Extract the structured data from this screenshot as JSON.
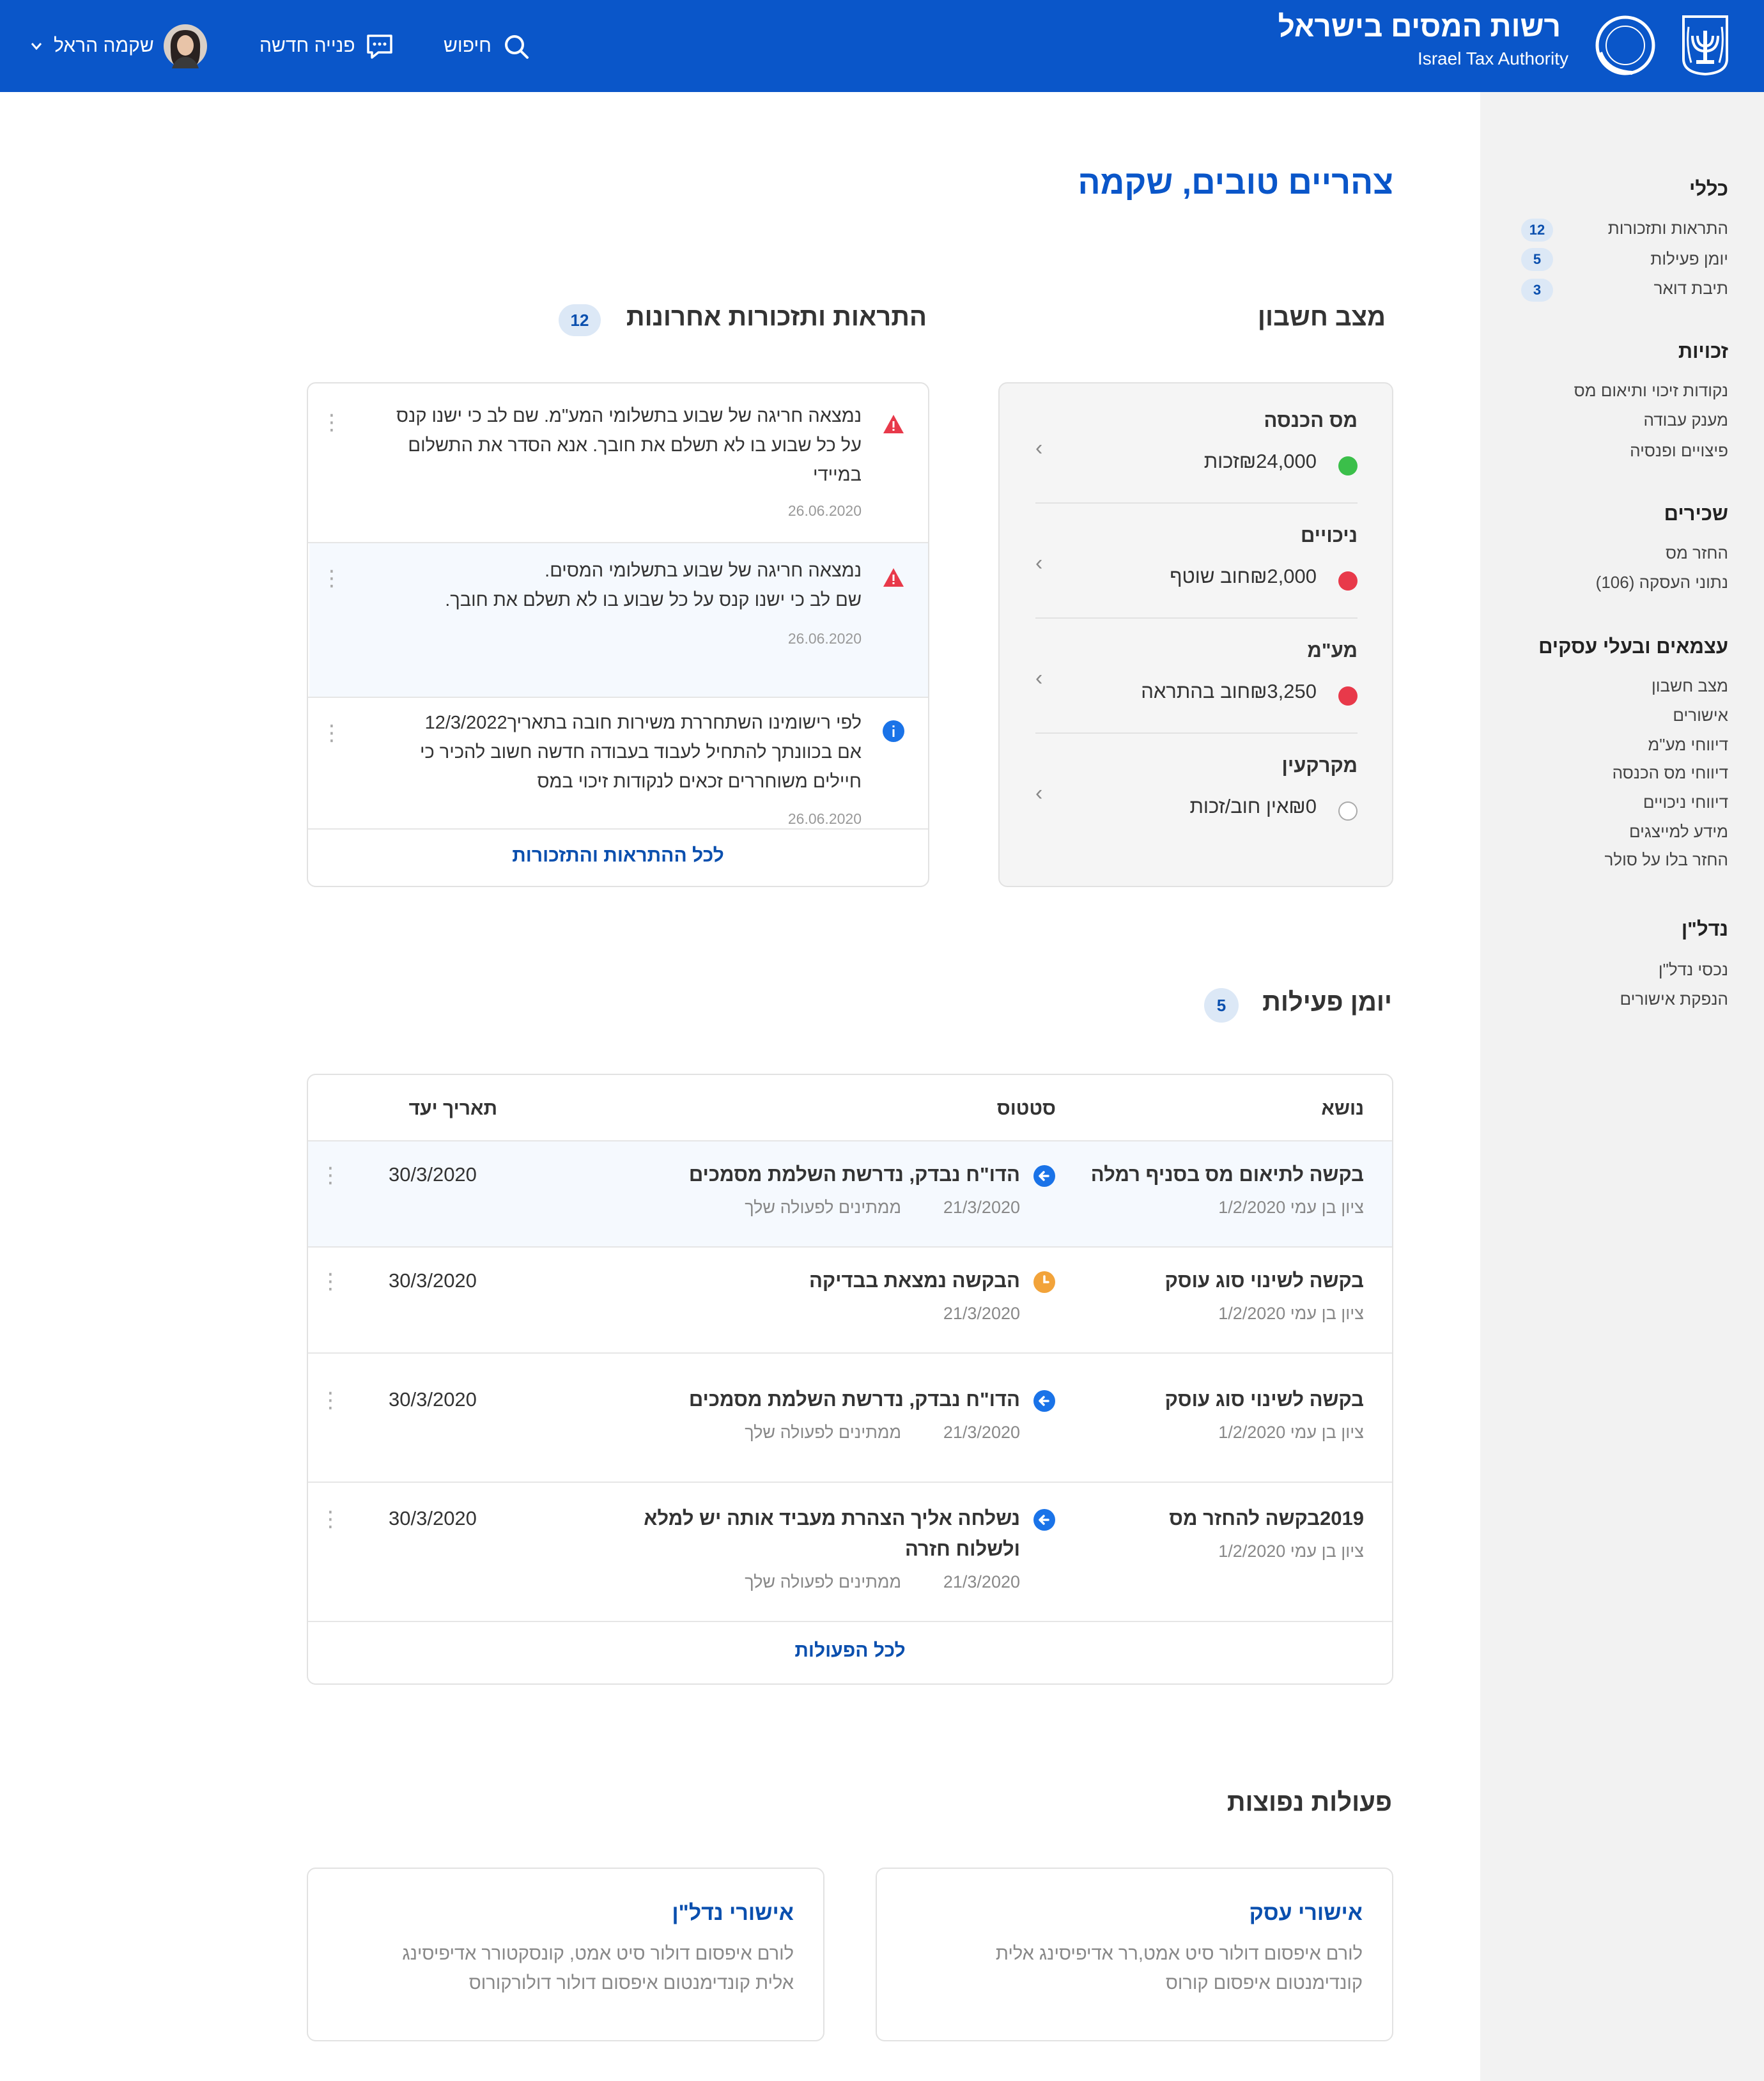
{
  "header": {
    "brand_he": "רשות המסים בישראל",
    "brand_en": "Israel Tax Authority",
    "search_label": "חיפוש",
    "new_inquiry_label": "פנייה חדשה",
    "user_name": "שקמה הראל"
  },
  "sidebar": {
    "sections": [
      {
        "title": "כללי",
        "items": [
          {
            "label": "התראות ותזכורות",
            "badge": "12"
          },
          {
            "label": "יומן פעילות",
            "badge": "5"
          },
          {
            "label": "תיבת דואר",
            "badge": "3"
          }
        ]
      },
      {
        "title": "זכויות",
        "items": [
          {
            "label": "נקודות זיכוי ותיאום מס"
          },
          {
            "label": "מענק עבודה"
          },
          {
            "label": "פיצויים ופנסיה"
          }
        ]
      },
      {
        "title": "שכירים",
        "items": [
          {
            "label": "החזר מס"
          },
          {
            "label": "(106) נתוני העסקה"
          }
        ]
      },
      {
        "title": "עצמאים ובעלי עסקים",
        "items": [
          {
            "label": "מצב חשבון"
          },
          {
            "label": "אישורים"
          },
          {
            "label": "דיווחי מע\"מ"
          },
          {
            "label": "דיווחי מס הכנסה"
          },
          {
            "label": "דיווחי ניכויים"
          },
          {
            "label": "מידע למייצגים"
          },
          {
            "label": "החזר בלו על סולר"
          }
        ]
      },
      {
        "title": "נדל\"ן",
        "items": [
          {
            "label": "נכסי נדל\"ן"
          },
          {
            "label": "הנפקת אישורים"
          }
        ]
      }
    ]
  },
  "main": {
    "greeting": "צהריים טובים, שקמה",
    "account": {
      "title": "מצב חשבון",
      "rows": [
        {
          "label": "מס הכנסה",
          "value": "₪24,000זכות",
          "status_color": "#3bbf4a"
        },
        {
          "label": "ניכויים",
          "value": "₪2,000חוב שוטף",
          "status_color": "#e8394a"
        },
        {
          "label": "מע\"מ",
          "value": "₪3,250חוב בהתראה",
          "status_color": "#e8394a"
        },
        {
          "label": "מקרקעין",
          "value": "₪0אין חוב/זכות",
          "status_color": "none"
        }
      ]
    },
    "alerts": {
      "title": "התראות ותזכורות אחרונות",
      "count": "12",
      "items": [
        {
          "type": "warning",
          "lines": [
            "נמצאה חריגה של שבוע בתשלומי המע\"מ. שם לב כי ישנו קנס",
            "על כל שבוע בו לא תשלם את חובך. אנא הסדר את התשלום",
            "במיידי"
          ],
          "date": "26.06.2020"
        },
        {
          "type": "warning",
          "lines": [
            "נמצאה חריגה של שבוע בתשלומי המסים.",
            "שם לב כי ישנו קנס על כל שבוע בו לא תשלם את חובך."
          ],
          "date": "26.06.2020"
        },
        {
          "type": "info",
          "lines": [
            "לפי רישומינו השתחררת משירות חובה בתאריך12/3/2022",
            "אם בכוונתך להתחיל לעבוד בעבודה חדשה חשוב להכיר כי",
            "חיילים משוחררים זכאים לנקודות זיכוי במס"
          ],
          "date": "26.06.2020"
        }
      ],
      "all_link": "לכל ההתראות והתזכורות"
    },
    "activity": {
      "title": "יומן פעילות",
      "count": "5",
      "columns": {
        "subject": "נושא",
        "status": "סטטוס",
        "due": "תאריך יעד"
      },
      "rows": [
        {
          "subject": "בקשה לתיאום מס בסניף רמלה",
          "subject_sub": "ציון בן עמי 1/2/2020",
          "status": "הדו\"ח נבדק, נדרשת השלמת מסמכים",
          "status_lines": [
            "הדו\"ח נבדק, נדרשת השלמת מסמכים"
          ],
          "status_date": "21/3/2020",
          "status_note": "ממתינים לפעולה שלך",
          "icon": "arrow",
          "due": "30/3/2020"
        },
        {
          "subject": "בקשה לשינוי סוג עוסק",
          "subject_sub": "ציון בן עמי 1/2/2020",
          "status_lines": [
            "הבקשה נמצאת בבדיקה"
          ],
          "status_date": "21/3/2020",
          "status_note": "",
          "icon": "clock",
          "due": "30/3/2020"
        },
        {
          "subject": "בקשה לשינוי סוג עוסק",
          "subject_sub": "ציון בן עמי 1/2/2020",
          "status_lines": [
            "הדו\"ח נבדק, נדרשת השלמת מסמכים"
          ],
          "status_date": "21/3/2020",
          "status_note": "ממתינים לפעולה שלך",
          "icon": "arrow",
          "due": "30/3/2020"
        },
        {
          "subject": "2019בקשה להחזר מס",
          "subject_sub": "ציון בן עמי 1/2/2020",
          "status_lines": [
            "נשלחה אליך הצהרת מעביד אותה יש למלא",
            "ולשלוח חזרה"
          ],
          "status_date": "21/3/2020",
          "status_note": "ממתינים לפעולה שלך",
          "icon": "arrow",
          "due": "30/3/2020"
        }
      ],
      "all_link": "לכל הפעולות"
    },
    "popular": {
      "title": "פעולות נפוצות",
      "cards": [
        {
          "title": "אישורי עסק",
          "lines": [
            "לורם איפסום דולור סיט אמט,רר אדיפיסינג אלית",
            "קונדימנטום איפסום קורוס"
          ]
        },
        {
          "title": "אישורי נדל\"ן",
          "lines": [
            "לורם איפסום דולור סיט אמט, קונסקטורר אדיפיסינג",
            "אלית קונדימנטום איפסום דולור דולורקורוס"
          ]
        }
      ]
    }
  },
  "colors": {
    "brand": "#0a56c9",
    "link": "#0a4fae",
    "warning": "#e8394a",
    "success": "#3bbf4a",
    "pending": "#f2a33a"
  }
}
